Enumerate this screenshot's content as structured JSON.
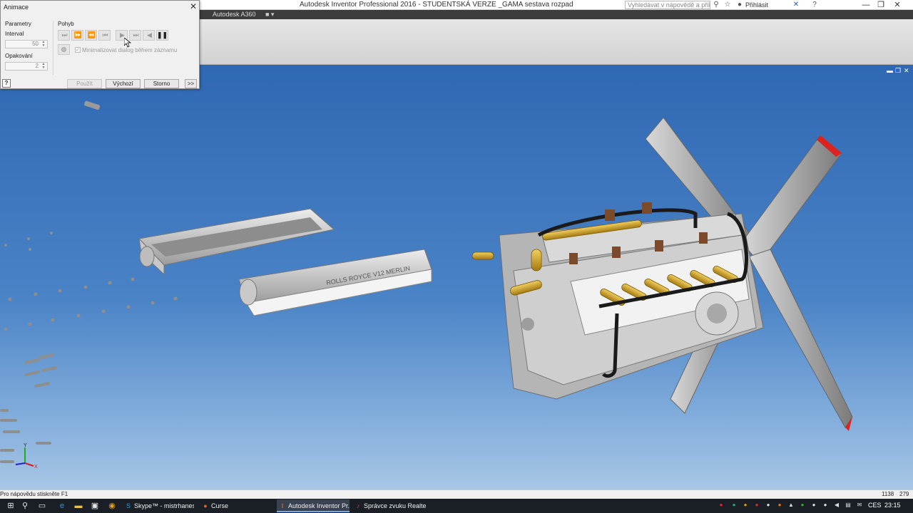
{
  "title_bar": {
    "app_title": "Autodesk Inventor Professional 2016 - STUDENTSKÁ VERZE    _GAMA sestava rozpad",
    "search_placeholder": "Vyhledávat v nápovědě a příkaze",
    "sign_in": "Přihlásit",
    "minimize": "—",
    "maximize": "❐",
    "close": "✕"
  },
  "ribbon": {
    "tab_a360": "Autodesk A360"
  },
  "dialog": {
    "title": "Animace",
    "close": "✕",
    "parameters_label": "Parametry",
    "interval_label": "Interval",
    "interval_value": "50",
    "repeat_label": "Opakování",
    "repeat_value": "2",
    "motion_label": "Pohyb",
    "motion_buttons": [
      {
        "name": "end-forward",
        "glyph": "⏭"
      },
      {
        "name": "fast-forward",
        "glyph": "⏩"
      },
      {
        "name": "fast-backward",
        "glyph": "⏪"
      },
      {
        "name": "start-back",
        "glyph": "⏮"
      },
      {
        "name": "play-forward",
        "glyph": "▶"
      },
      {
        "name": "step-forward",
        "glyph": "⏭"
      },
      {
        "name": "play-backward",
        "glyph": "◀"
      },
      {
        "name": "pause",
        "glyph": "❚❚"
      }
    ],
    "minimize_checkbox_label": "Minimalizovat dialog během záznamu",
    "apply_button": "Použít",
    "default_button": "Výchozí",
    "cancel_button": "Storno",
    "expand_button": ">>",
    "help_button": "?"
  },
  "viewport": {
    "label_text": "ROLLS ROYCE V12 MERLIN",
    "axis_y": "Y",
    "axis_x": "X"
  },
  "status_bar": {
    "hint": "Pro nápovědu stiskněte F1",
    "count_a": "1138",
    "count_b": "279"
  },
  "taskbar": {
    "tasks": [
      {
        "label": "Skype™ - mistrhanes",
        "icon": "skype-icon"
      },
      {
        "label": "Curse",
        "icon": "curse-icon"
      },
      {
        "label": "Autodesk Inventor Pr...",
        "icon": "inventor-icon"
      },
      {
        "label": "Správce zvuku Realte...",
        "icon": "audio-icon"
      }
    ],
    "language": "CES",
    "time": "23:15"
  },
  "colors": {
    "viewport_top": "#2f68b3",
    "viewport_bottom": "#a8c6e6",
    "engine_gold": "#c8a030",
    "engine_gray": "#b5b5b5",
    "taskbar": "#1a1f26"
  }
}
